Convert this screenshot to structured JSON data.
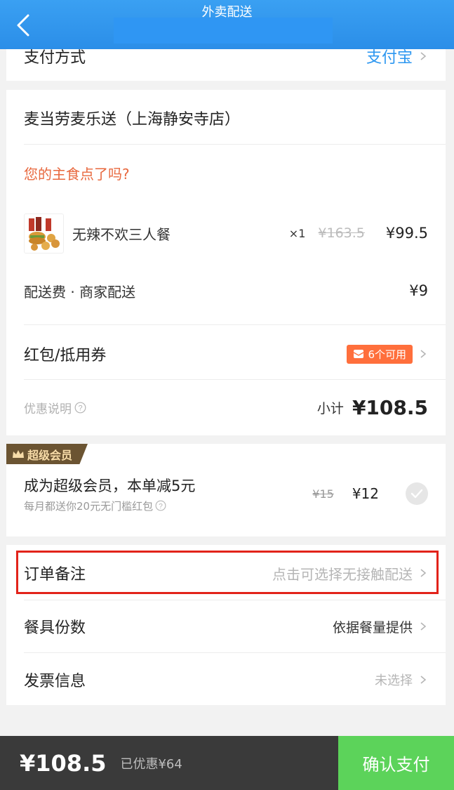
{
  "header": {
    "title": "外卖配送"
  },
  "payment": {
    "label": "支付方式",
    "method": "支付宝"
  },
  "store": {
    "name": "麦当劳麦乐送（上海静安寺店）",
    "prompt": "您的主食点了吗?",
    "item": {
      "name": "无辣不欢三人餐",
      "qty": "×1",
      "original_price": "¥163.5",
      "price": "¥99.5"
    },
    "delivery": {
      "label": "配送费 · 商家配送",
      "fee": "¥9"
    },
    "coupon": {
      "label": "红包/抵用券",
      "badge": "6个可用"
    },
    "discount_info": "优惠说明",
    "subtotal_label": "小计",
    "subtotal": "¥108.5"
  },
  "membership": {
    "tag": "超级会员",
    "title": "成为超级会员，本单减5元",
    "subtitle": "每月都送你20元无门槛红包",
    "original_price": "¥15",
    "price": "¥12"
  },
  "extras": {
    "note_label": "订单备注",
    "note_hint": "点击可选择无接触配送",
    "utensils_label": "餐具份数",
    "utensils_value": "依据餐量提供",
    "invoice_label": "发票信息",
    "invoice_value": "未选择"
  },
  "footer": {
    "total": "¥108.5",
    "saved": "已优惠¥64",
    "confirm": "确认支付"
  },
  "colors": {
    "header_blue": "#2b8ee8",
    "link_blue": "#2b96f0",
    "prompt_orange": "#e8683e",
    "coupon_orange": "#ff6f3c",
    "confirm_green": "#5cd35a",
    "highlight_red": "#e2231a"
  }
}
